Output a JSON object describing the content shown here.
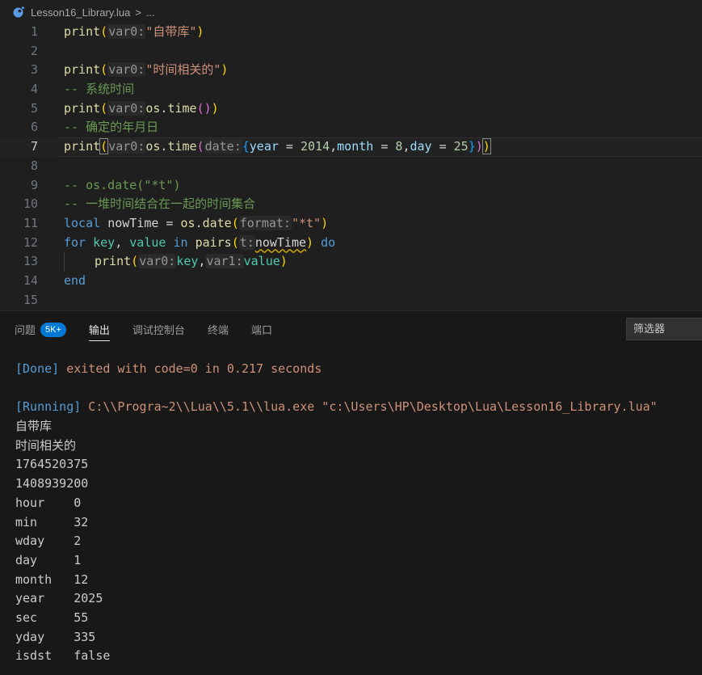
{
  "breadcrumb": {
    "file": "Lesson16_Library.lua",
    "sep": ">",
    "more": "..."
  },
  "code_lines": [
    {
      "n": "1"
    },
    {
      "n": "2"
    },
    {
      "n": "3"
    },
    {
      "n": "4"
    },
    {
      "n": "5"
    },
    {
      "n": "6"
    },
    {
      "n": "7"
    },
    {
      "n": "8"
    },
    {
      "n": "9"
    },
    {
      "n": "10"
    },
    {
      "n": "11"
    },
    {
      "n": "12"
    },
    {
      "n": "13"
    },
    {
      "n": "14"
    },
    {
      "n": "15"
    }
  ],
  "code": {
    "l1_print": "print",
    "l1_hint": "var0:",
    "l1_str": "\"自带库\"",
    "l3_print": "print",
    "l3_hint": "var0:",
    "l3_str": "\"时间相关的\"",
    "l4_cmt": "-- 系统时间",
    "l5_print": "print",
    "l5_hint": "var0:",
    "l5_os": "os",
    "l5_time": "time",
    "l6_cmt": "-- 确定的年月日",
    "l7_print": "print",
    "l7_hint": "var0:",
    "l7_os": "os",
    "l7_time": "time",
    "l7_hint2": "date:",
    "l7_year": "year",
    "l7_yv": "2014",
    "l7_month": "month",
    "l7_mv": "8",
    "l7_day": "day",
    "l7_dv": "25",
    "l9_cmt": "-- os.date(\"*t\")",
    "l10_cmt": "-- 一堆时间结合在一起的时间集合",
    "l11_local": "local",
    "l11_var": "nowTime",
    "l11_os": "os",
    "l11_date": "date",
    "l11_hint": "format:",
    "l11_str": "\"*t\"",
    "l12_for": "for",
    "l12_key": "key",
    "l12_value": "value",
    "l12_in": "in",
    "l12_pairs": "pairs",
    "l12_hint": "t:",
    "l12_arg": "nowTime",
    "l12_do": "do",
    "l13_print": "print",
    "l13_hint": "var0:",
    "l13_key": "key",
    "l13_hint2": "var1:",
    "l13_value": "value",
    "l14_end": "end"
  },
  "panel": {
    "tabs": {
      "problems": "问题",
      "badge": "5K+",
      "output": "输出",
      "debug": "调试控制台",
      "terminal": "终端",
      "ports": "端口"
    },
    "filter_placeholder": "筛选器"
  },
  "output": {
    "done_tag": "[Done]",
    "done_text": " exited with code=0 in 0.217 seconds",
    "running_tag": "[Running]",
    "running_cmd": " C:\\\\Progra~2\\\\Lua\\\\5.1\\\\lua.exe \"c:\\Users\\HP\\Desktop\\Lua\\Lesson16_Library.lua\"",
    "lines": [
      "自带库",
      "时间相关的",
      "1764520375",
      "1408939200",
      "hour\t0",
      "min\t32",
      "wday\t2",
      "day\t1",
      "month\t12",
      "year\t2025",
      "sec\t55",
      "yday\t335",
      "isdst\tfalse"
    ]
  },
  "colors": {
    "accent": "#0078d4",
    "keyword": "#c586c0",
    "function": "#dcdcaa",
    "string": "#ce9178",
    "comment": "#6a9955"
  }
}
